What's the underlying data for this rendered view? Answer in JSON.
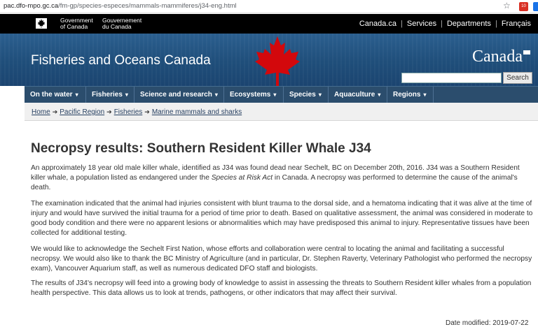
{
  "browser": {
    "url_host": "pac.dfo-mpo.gc.ca",
    "url_path": "/fm-gp/species-especes/mammals-mammiferes/j34-eng.html",
    "ext_badge": "10"
  },
  "fip": {
    "gov_en_line1": "Government",
    "gov_en_line2": "of Canada",
    "gov_fr_line1": "Gouvernement",
    "gov_fr_line2": "du Canada",
    "links": [
      "Canada.ca",
      "Services",
      "Departments",
      "Français"
    ]
  },
  "banner": {
    "site_title": "Fisheries and Oceans Canada",
    "wordmark": "Canada",
    "search_placeholder": "",
    "search_label": "Search",
    "accent_color": "#d3080c"
  },
  "menu": {
    "items": [
      "On the water",
      "Fisheries",
      "Science and research",
      "Ecosystems",
      "Species",
      "Aquaculture",
      "Regions"
    ]
  },
  "breadcrumb": [
    "Home",
    "Pacific Region",
    "Fisheries",
    "Marine mammals and sharks"
  ],
  "page": {
    "title": "Necropsy results: Southern Resident Killer Whale J34",
    "p1_before": "An approximately 18 year old male killer whale, identified as J34 was found dead near Sechelt, BC on December 20th, 2016. J34 was a Southern Resident killer whale, a population listed as endangered under the ",
    "p1_italic": "Species at Risk Act",
    "p1_after": " in Canada. A necropsy was performed to determine the cause of the animal's death.",
    "p2": "The examination indicated that the animal had injuries consistent with blunt trauma to the dorsal side, and a hematoma indicating that it was alive at the time of injury and would have survived the initial trauma for a period of time prior to death. Based on qualitative assessment, the animal was considered in moderate to good body condition and there were no apparent lesions or abnormalities which may have predisposed this animal to injury. Representative tissues have been collected for additional testing.",
    "p3": "We would like to acknowledge the Sechelt First Nation, whose efforts and collaboration were central to locating the animal and facilitating a successful necropsy. We would also like to thank the BC Ministry of Agriculture (and in particular, Dr. Stephen Raverty, Veterinary Pathologist who performed the necropsy exam), Vancouver Aquarium staff, as well as numerous dedicated DFO staff and biologists.",
    "p4": "The results of J34's necropsy will feed into a growing body of knowledge to assist in assessing the threats to Southern Resident killer whales from a population health perspective. This data allows us to look at trends, pathogens, or other indicators that may affect their survival.",
    "date_modified": "Date modified: 2019-07-22"
  }
}
